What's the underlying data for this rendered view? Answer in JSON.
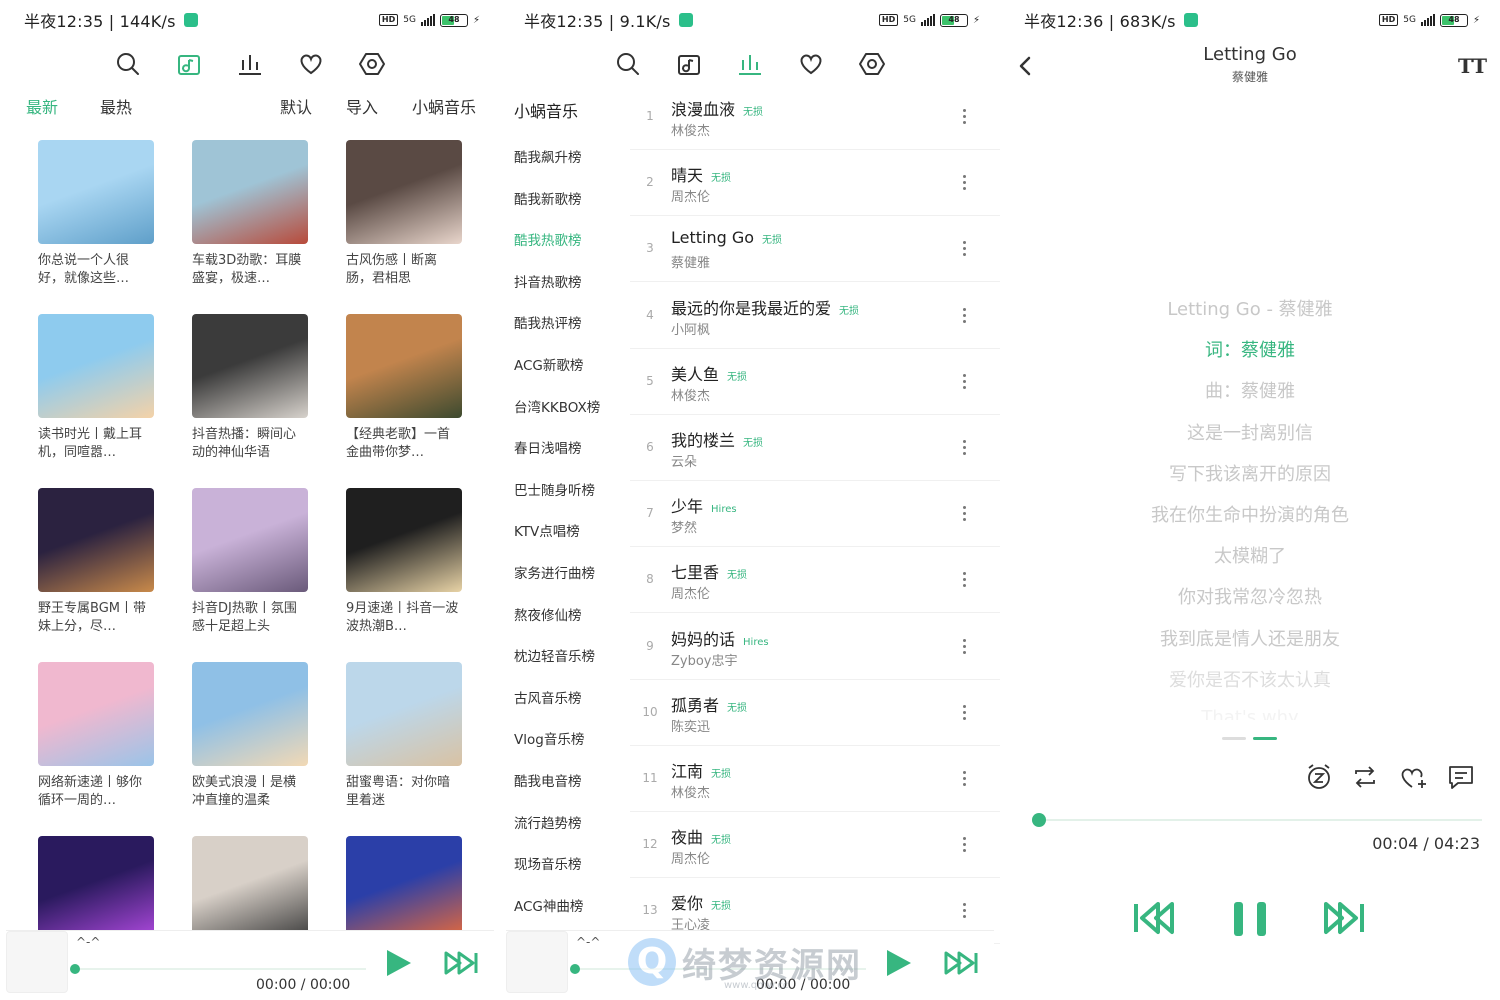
{
  "status_bars": [
    {
      "time": "半夜12:35 | 144K/s",
      "network": "5G",
      "battery": "48"
    },
    {
      "time": "半夜12:35 | 9.1K/s",
      "network": "5G",
      "battery": "48"
    },
    {
      "time": "半夜12:36 | 683K/s",
      "network": "5G",
      "battery": "48"
    }
  ],
  "status_hd": "HD",
  "accent_color": "#37b680",
  "top_nav_icons": [
    "search-icon",
    "music-note-icon",
    "chart-bars-icon",
    "heart-icon",
    "settings-icon"
  ],
  "home": {
    "tabs": {
      "latest": "最新",
      "hottest": "最热",
      "default": "默认",
      "import": "导入",
      "source": "小蜗音乐"
    },
    "playlists": [
      {
        "title": "你总说一个人很好，就像这些…",
        "color1": "#a9d6f2",
        "color2": "#5f9fc9"
      },
      {
        "title": "车载3D劲歌：耳膜盛宴，极速…",
        "color1": "#9fc4d6",
        "color2": "#b84a3a"
      },
      {
        "title": "古风伤感丨断离肠，君相思",
        "color1": "#5a4a44",
        "color2": "#e9d6cc"
      },
      {
        "title": "读书时光丨戴上耳机，同喧嚣…",
        "color1": "#8ecbee",
        "color2": "#f4d2a8"
      },
      {
        "title": "抖音热播：瞬间心动的神仙华语",
        "color1": "#3b3b3b",
        "color2": "#d7d2cc"
      },
      {
        "title": "【经典老歌】一首金曲带你梦…",
        "color1": "#c2844d",
        "color2": "#3d4a2f"
      },
      {
        "title": "野王专属BGM丨带妹上分，尽…",
        "color1": "#2b2240",
        "color2": "#c98a4a"
      },
      {
        "title": "抖音DJ热歌丨氛围感十足超上头",
        "color1": "#c9b2d8",
        "color2": "#6a5a7a"
      },
      {
        "title": "9月速递丨抖音一波波热潮B…",
        "color1": "#1f1f1f",
        "color2": "#e8d3a6"
      },
      {
        "title": "网络新速递丨够你循环一周的…",
        "color1": "#f0b8cf",
        "color2": "#9ac4e8"
      },
      {
        "title": "欧美式浪漫丨是横冲直撞的温柔",
        "color1": "#8fc0e6",
        "color2": "#f2d9b5"
      },
      {
        "title": "甜蜜粤语：对你暗里着迷",
        "color1": "#bcd7ea",
        "color2": "#d9c2a3"
      },
      {
        "title": "",
        "color1": "#2a1a5e",
        "color2": "#b04ae0"
      },
      {
        "title": "",
        "color1": "#d8d0c8",
        "color2": "#3a3a3a"
      },
      {
        "title": "",
        "color1": "#2b3fa8",
        "color2": "#e86a3a"
      }
    ],
    "mini_player": {
      "title": "^-^",
      "time": "00:00 / 00:00",
      "progress": 0
    }
  },
  "charts": {
    "source": "小蜗音乐",
    "active_index": 2,
    "list": [
      "酷我飙升榜",
      "酷我新歌榜",
      "酷我热歌榜",
      "抖音热歌榜",
      "酷我热评榜",
      "ACG新歌榜",
      "台湾KKBOX榜",
      "春日浅唱榜",
      "巴士随身听榜",
      "KTV点唱榜",
      "家务进行曲榜",
      "熬夜修仙榜",
      "枕边轻音乐榜",
      "古风音乐榜",
      "Vlog音乐榜",
      "酷我电音榜",
      "流行趋势榜",
      "现场音乐榜",
      "ACG神曲榜"
    ],
    "songs": [
      {
        "num": "1",
        "name": "浪漫血液",
        "quality": "无损",
        "artist": "林俊杰"
      },
      {
        "num": "2",
        "name": "晴天",
        "quality": "无损",
        "artist": "周杰伦"
      },
      {
        "num": "3",
        "name": "Letting Go",
        "quality": "无损",
        "artist": "蔡健雅"
      },
      {
        "num": "4",
        "name": "最远的你是我最近的爱",
        "quality": "无损",
        "artist": "小阿枫"
      },
      {
        "num": "5",
        "name": "美人鱼",
        "quality": "无损",
        "artist": "林俊杰"
      },
      {
        "num": "6",
        "name": "我的楼兰",
        "quality": "无损",
        "artist": "云朵"
      },
      {
        "num": "7",
        "name": "少年",
        "quality": "Hires",
        "artist": "梦然"
      },
      {
        "num": "8",
        "name": "七里香",
        "quality": "无损",
        "artist": "周杰伦"
      },
      {
        "num": "9",
        "name": "妈妈的话",
        "quality": "Hires",
        "artist": "Zyboy忠宇"
      },
      {
        "num": "10",
        "name": "孤勇者",
        "quality": "无损",
        "artist": "陈奕迅"
      },
      {
        "num": "11",
        "name": "江南",
        "quality": "无损",
        "artist": "林俊杰"
      },
      {
        "num": "12",
        "name": "夜曲",
        "quality": "无损",
        "artist": "周杰伦"
      },
      {
        "num": "13",
        "name": "爱你",
        "quality": "无损",
        "artist": "王心凌"
      }
    ],
    "mini_player": {
      "title": "^-^",
      "time": "00:00 / 00:00",
      "progress": 0
    }
  },
  "watermark": {
    "letter": "Q",
    "text": "绮梦资源网",
    "url": "www.qmw.cc"
  },
  "now_playing": {
    "title": "Letting Go",
    "artist": "蔡健雅",
    "font_button": "TT",
    "lyrics": [
      "Letting Go - 蔡健雅",
      "词：蔡健雅",
      "曲：蔡健雅",
      "这是一封离别信",
      "写下我该离开的原因",
      "我在你生命中扮演的角色",
      "太模糊了",
      "你对我常忽冷忽热",
      "我到底是情人还是朋友",
      "爱你是否不该太认真",
      "That's why"
    ],
    "current_lyric_index": 1,
    "lyric_page": 2,
    "lyric_pages": 2,
    "time": "00:04 / 04:23",
    "progress": 0.016,
    "state": "playing"
  }
}
